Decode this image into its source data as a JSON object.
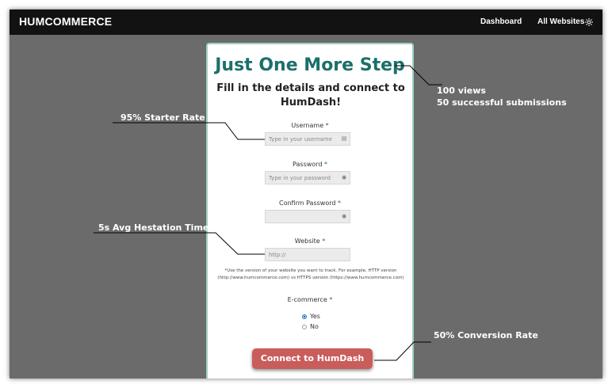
{
  "app": {
    "brand": "HUMCOMMERCE"
  },
  "nav": {
    "dashboard": "Dashboard",
    "all_websites": "All Websites"
  },
  "form": {
    "title": "Just One More Step",
    "subtitle": "Fill in the details and connect to HumDash!",
    "required_mark": "*",
    "username": {
      "label": "Username",
      "placeholder": "Type in your username"
    },
    "password": {
      "label": "Password",
      "placeholder": "Type in your password"
    },
    "confirm_password": {
      "label": "Confirm Password",
      "placeholder": ""
    },
    "website": {
      "label": "Website",
      "placeholder": "http://"
    },
    "note": "*Use the version of your website you want to track. For example, HTTP version (http://www.humcommerce.com) vs HTTPS version (https://www.humcommerce.com)",
    "ecommerce": {
      "label": "E-commerce",
      "options": [
        "Yes",
        "No"
      ],
      "selected": "Yes"
    },
    "submit_label": "Connect to HumDash"
  },
  "annotations": {
    "views": "100 views",
    "submissions": "50 successful submissions",
    "starter_rate": "95% Starter Rate",
    "hesitation": "5s Avg Hestation Time",
    "conversion": "50% Conversion Rate"
  },
  "colors": {
    "accent": "#1d6f6b",
    "button": "#c95d5b",
    "background": "#6b6b6b",
    "topbar": "#121212"
  }
}
